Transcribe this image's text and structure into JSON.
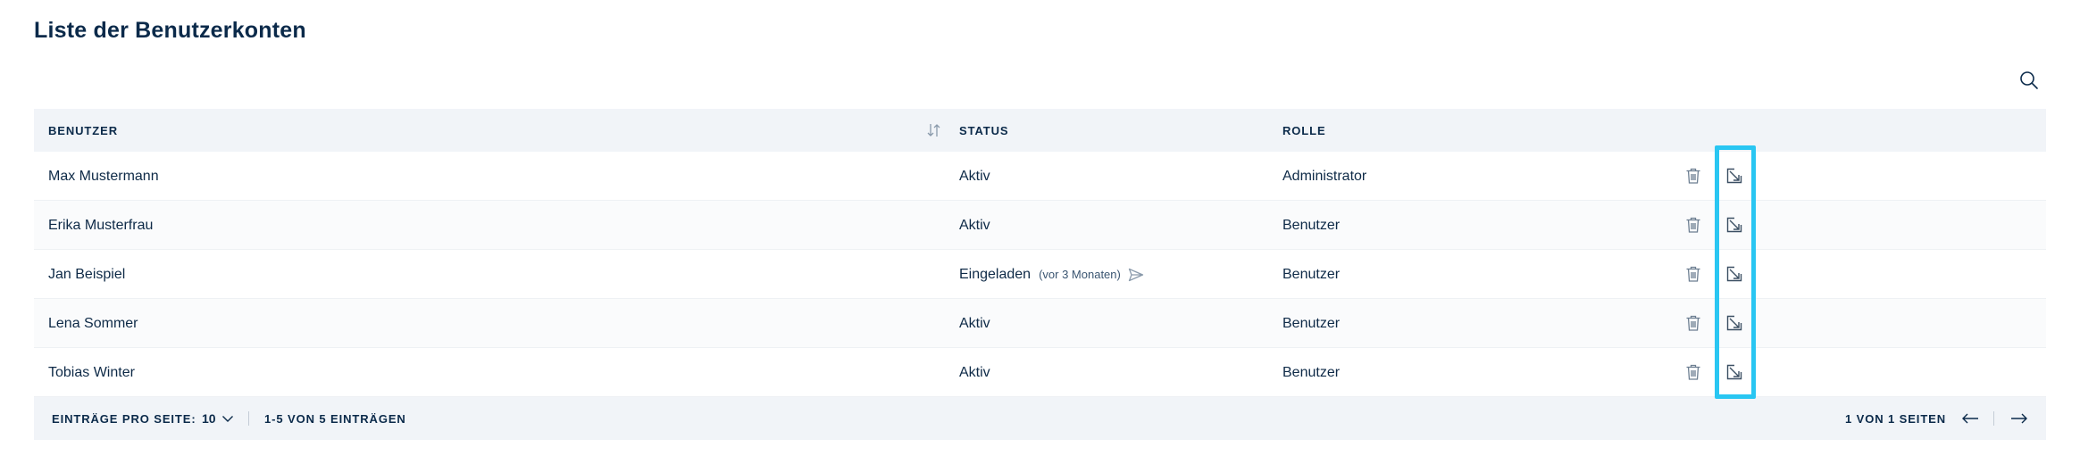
{
  "page": {
    "title": "Liste der Benutzerkonten"
  },
  "table": {
    "columns": {
      "user": "BENUTZER",
      "status": "STATUS",
      "role": "ROLLE"
    },
    "rows": [
      {
        "user": "Max Mustermann",
        "status": "Aktiv",
        "note": "",
        "role": "Administrator"
      },
      {
        "user": "Erika Musterfrau",
        "status": "Aktiv",
        "note": "",
        "role": "Benutzer"
      },
      {
        "user": "Jan Beispiel",
        "status": "Eingeladen",
        "note": "(vor 3 Monaten)",
        "role": "Benutzer"
      },
      {
        "user": "Lena Sommer",
        "status": "Aktiv",
        "note": "",
        "role": "Benutzer"
      },
      {
        "user": "Tobias Winter",
        "status": "Aktiv",
        "note": "",
        "role": "Benutzer"
      }
    ]
  },
  "footer": {
    "per_page_label": "EINTRÄGE PRO SEITE:",
    "per_page_value": "10",
    "range": "1-5 VON 5 EINTRÄGEN",
    "pages": "1 VON 1 SEITEN"
  },
  "icons": {
    "search": "search-icon",
    "sort": "sort-icon",
    "delete": "trash-icon",
    "edit": "edit-icon",
    "resend": "send-icon",
    "prev": "arrow-left-icon",
    "next": "arrow-right-icon",
    "dropdown": "chevron-down-icon"
  },
  "colors": {
    "text": "#0b2a4a",
    "header_bg": "#f1f4f8",
    "highlight": "#29c6f2"
  }
}
